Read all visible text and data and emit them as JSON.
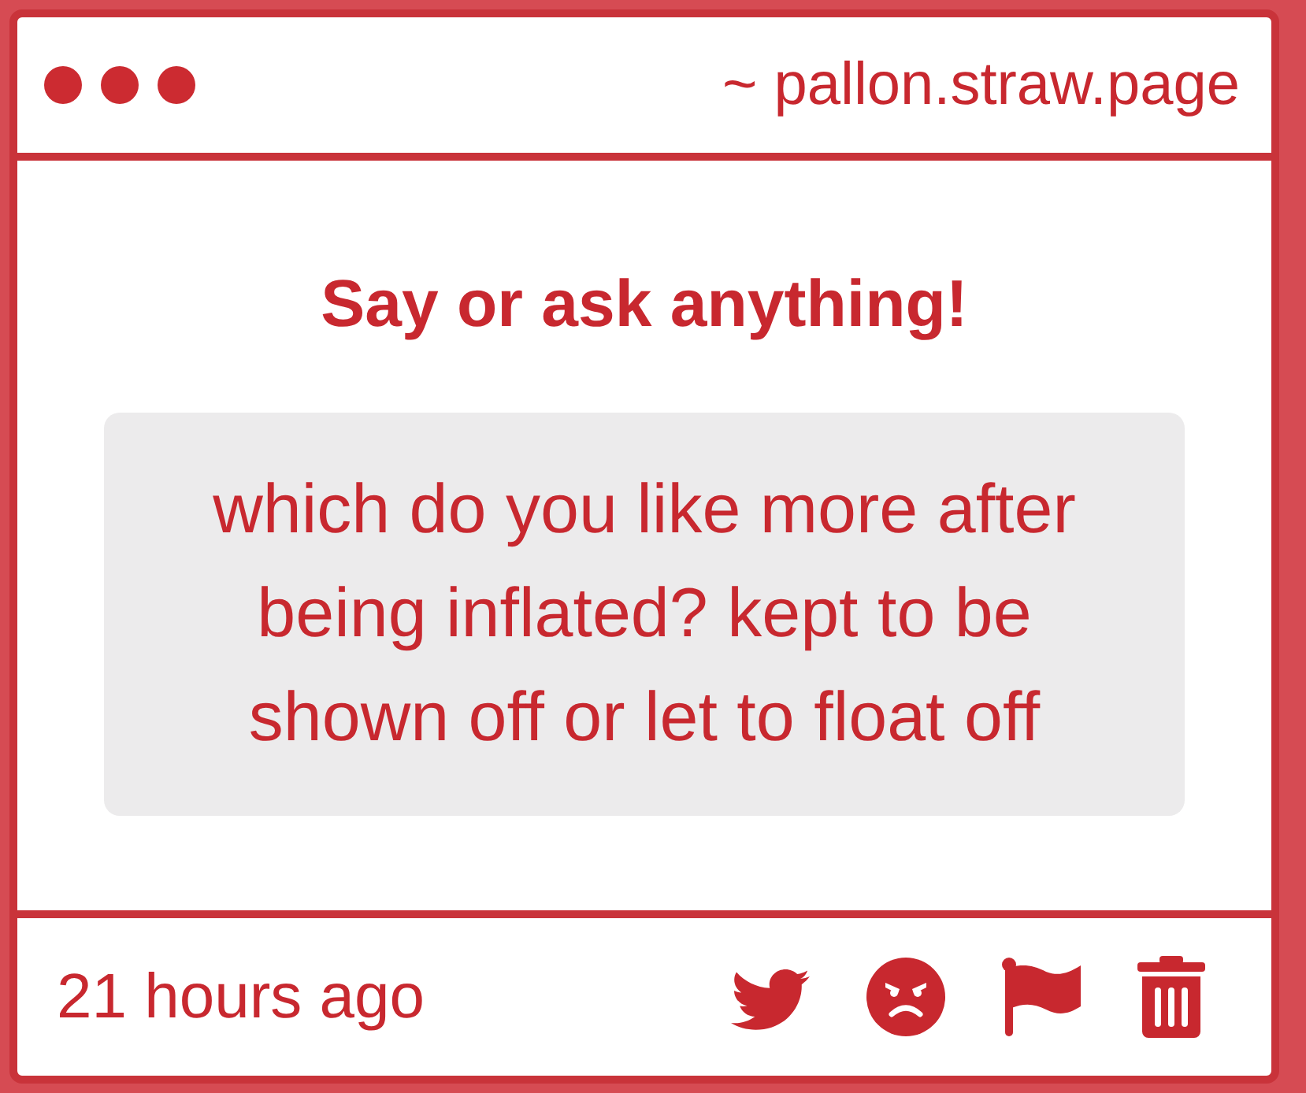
{
  "header": {
    "address": "~ pallon.straw.page"
  },
  "prompt": {
    "title": "Say or ask anything!"
  },
  "message": {
    "text": "which do you like more after being inflated? kept to be shown off or let to float off"
  },
  "footer": {
    "time": "21 hours ago",
    "actions": [
      {
        "kind": "bird"
      },
      {
        "kind": "angry"
      },
      {
        "kind": "flag"
      },
      {
        "kind": "trash"
      }
    ]
  }
}
